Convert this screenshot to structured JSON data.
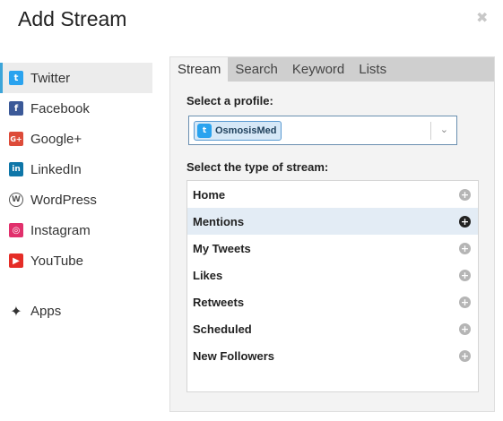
{
  "dialog": {
    "title": "Add Stream",
    "close_glyph": "✖"
  },
  "sidebar": {
    "items": [
      {
        "label": "Twitter",
        "icon": "twitter-icon",
        "glyph": "t",
        "active": true
      },
      {
        "label": "Facebook",
        "icon": "facebook-icon",
        "glyph": "f",
        "active": false
      },
      {
        "label": "Google+",
        "icon": "google-plus-icon",
        "glyph": "G+",
        "active": false
      },
      {
        "label": "LinkedIn",
        "icon": "linkedin-icon",
        "glyph": "in",
        "active": false
      },
      {
        "label": "WordPress",
        "icon": "wordpress-icon",
        "glyph": "W",
        "active": false
      },
      {
        "label": "Instagram",
        "icon": "instagram-icon",
        "glyph": "◎",
        "active": false
      },
      {
        "label": "YouTube",
        "icon": "youtube-icon",
        "glyph": "▶",
        "active": false
      }
    ],
    "apps": {
      "label": "Apps",
      "icon": "puzzle-icon",
      "glyph": "✦"
    }
  },
  "tabs": [
    {
      "label": "Stream",
      "active": true
    },
    {
      "label": "Search",
      "active": false
    },
    {
      "label": "Keyword",
      "active": false
    },
    {
      "label": "Lists",
      "active": false
    }
  ],
  "profile": {
    "label": "Select a profile:",
    "selected": "OsmosisMed",
    "badge_glyph": "t",
    "chevron_glyph": "⌄"
  },
  "stream_types": {
    "label": "Select the type of stream:",
    "add_glyph": "+",
    "items": [
      {
        "label": "Home",
        "selected": false
      },
      {
        "label": "Mentions",
        "selected": true
      },
      {
        "label": "My Tweets",
        "selected": false
      },
      {
        "label": "Likes",
        "selected": false
      },
      {
        "label": "Retweets",
        "selected": false
      },
      {
        "label": "Scheduled",
        "selected": false
      },
      {
        "label": "New Followers",
        "selected": false
      }
    ]
  },
  "colors": {
    "accent": "#3da5d9",
    "selected_row": "#e3ecf5",
    "tab_bar": "#cfcfcf",
    "twitter": "#2aa3ef"
  }
}
